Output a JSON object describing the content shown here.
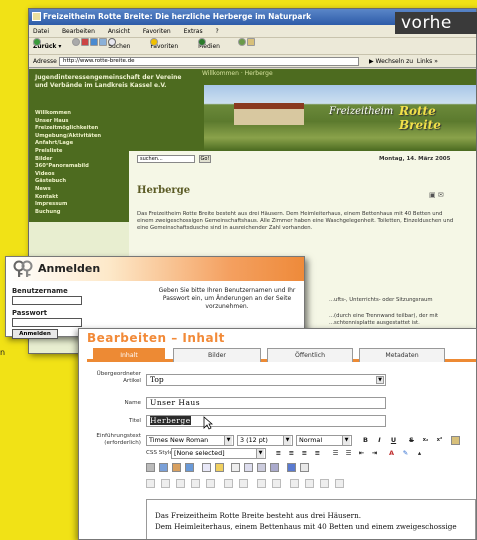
{
  "browser": {
    "window_title": "Freizeitheim Rotte Breite: Die herzliche Herberge im Naturpark",
    "menu": [
      "Datei",
      "Bearbeiten",
      "Ansicht",
      "Favoriten",
      "Extras",
      "?"
    ],
    "toolbar": {
      "back_label": "Zurück",
      "search_label": "Suchen",
      "favorites_label": "Favoriten",
      "media_label": "Medien"
    },
    "address": {
      "label": "Adresse",
      "url": "http://www.rotte-breite.de",
      "go_label": "Wechseln zu",
      "links_label": "Links"
    }
  },
  "overlay_word": "vorhe",
  "site": {
    "org_name": "Jugendinteressengemeinschaft der Vereine und Verbände im Landkreis Kassel e.V.",
    "breadcrumb": "Willkommen · Herberge",
    "logo_part1": "Freizeitheim",
    "logo_part2": "Rotte Breite",
    "nav": [
      "Willkommen",
      "Unser Haus",
      "Freizeitmöglichkeiten",
      "Umgebung/Aktivitäten",
      "Anfahrt/Lage",
      "Preisliste",
      "Bilder",
      "360°Panoramabild",
      "Videos",
      "Gästebuch",
      "News",
      "Kontakt",
      "Impressum",
      "Buchung"
    ],
    "search_value": "suchen...",
    "search_button": "Go!",
    "date": "Montag, 14. März 2005",
    "heading": "Herberge",
    "paragraph1": "Das Freizeitheim Rotte Breite besteht aus drei Häusern. Dem Heimleiterhaus, einem Bettenhaus mit 40 Betten und einem zweigeschossigen Gemeinschaftshaus. Alle Zimmer haben eine Waschgelegenheit. Toiletten, Einzelduschen und eine Gemeinschaftsdusche sind in ausreichender Zahl vorhanden.",
    "paragraph2": "...ufts-, Unterrichts- oder Sitzungsraum",
    "paragraph3": "...(durch eine Trennwand teilbar), der mit ...schtennisplatte ausgestattet ist."
  },
  "login": {
    "title": "Anmelden",
    "username_label": "Benutzername",
    "password_label": "Passwort",
    "submit_label": "Anmelden",
    "message": "Geben Sie bitte Ihren Benutzernamen und Ihr Passwort ein, um Änderungen an der Seite vorzunehmen.",
    "side_letter": "n"
  },
  "editor": {
    "title": "Bearbeiten – Inhalt",
    "tabs": [
      "Inhalt",
      "Bilder",
      "Öffentlich",
      "Metadaten"
    ],
    "parent_label": "Übergeordneter Artikel",
    "parent_value": "Top",
    "name_label": "Name",
    "name_value": "Unser Haus",
    "title_label": "Titel",
    "title_value": "Herberge",
    "intro_label": "Einführungstext (erforderlich)",
    "font_value": "Times New Roman",
    "size_value": "3 (12 pt)",
    "format_value": "Normal",
    "css_label": "CSS Styles",
    "css_value": "[None selected]",
    "text_line1": "Das Freizeitheim Rotte Breite besteht aus drei Häusern.",
    "text_line2": "Dem Heimleiterhaus, einem Bettenhaus mit 40 Betten und einem zweigeschossige"
  },
  "colors": {
    "background": "#f1e216",
    "accent_orange": "#ed8a34",
    "site_green": "#4d6b1f"
  }
}
